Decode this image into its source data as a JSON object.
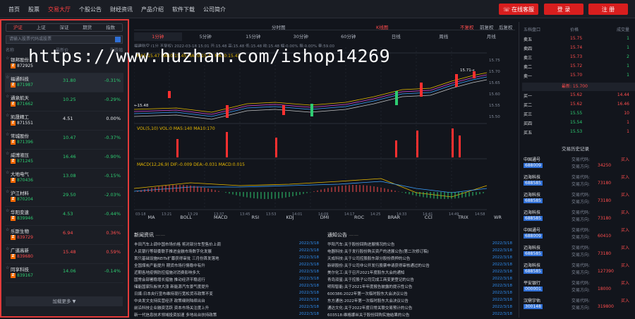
{
  "nav": {
    "items": [
      "首页",
      "股票",
      "交易大厅",
      "个股公告",
      "财经资讯",
      "产品介绍",
      "软件下载",
      "公司简介"
    ],
    "active_index": 2,
    "service_label": "在线客服",
    "login_label": "登 录",
    "register_label": "注 册"
  },
  "sidebar": {
    "tabs": [
      "沪证",
      "上证",
      "深证",
      "期货",
      "指数"
    ],
    "active_tab": 0,
    "search_placeholder": "请输入股票代码或股票",
    "headers": [
      "名称",
      "最新价",
      "涨跌幅"
    ],
    "load_more": "加载更多 ▼",
    "stocks": [
      {
        "name": "银邦股份",
        "code": "872925",
        "price": "",
        "change": "",
        "color": "wh"
      },
      {
        "name": "福通科技",
        "code": "871987",
        "price": "31.80",
        "change": "-0.31%",
        "color": "dn"
      },
      {
        "name": "通泉航天",
        "code": "871662",
        "price": "10.25",
        "change": "-0.29%",
        "color": "dn"
      },
      {
        "name": "凯晟精工",
        "code": "871551",
        "price": "4.51",
        "change": "0.00%",
        "color": "wh"
      },
      {
        "name": "常城股份",
        "code": "871396",
        "price": "10.47",
        "change": "-0.37%",
        "color": "dn"
      },
      {
        "name": "威博液压",
        "code": "871245",
        "price": "16.46",
        "change": "-0.90%",
        "color": "dn"
      },
      {
        "name": "大地电气",
        "code": "870436",
        "price": "13.08",
        "change": "-0.15%",
        "color": "dn"
      },
      {
        "name": "沪江材料",
        "code": "870204",
        "price": "29.50",
        "change": "-2.03%",
        "color": "dn"
      },
      {
        "name": "华阳变速",
        "code": "839946",
        "price": "4.53",
        "change": "-0.44%",
        "color": "dn"
      },
      {
        "name": "乐斯生物",
        "code": "839729",
        "price": "6.94",
        "change": "0.36%",
        "color": "up"
      },
      {
        "name": "广道高新",
        "code": "839680",
        "price": "15.48",
        "change": "0.59%",
        "color": "up"
      },
      {
        "name": "同享科技",
        "code": "839167",
        "price": "14.06",
        "change": "-0.14%",
        "color": "dn"
      }
    ]
  },
  "chart": {
    "period_tabs": [
      "分时图",
      "K线图",
      "不复权",
      "前复权",
      "后复权"
    ],
    "active_period": 1,
    "active_adjust": 2,
    "interval_tabs": [
      "1分钟",
      "5分钟",
      "15分钟",
      "30分钟",
      "60分钟",
      "日线",
      "周线",
      "月线"
    ],
    "active_interval": 0,
    "info_line": "福建航空 (1分 不复权) 2022-03-18 15:01 开:15.48 高:15.48 低:15.48 收:15.48 幅:0.00% 振:0.00% 量:59.00",
    "ma_line": "MA5:15.47  MA10:15.45  MA20:15.43  MA30:15.43",
    "vol_line": "VOL(5,10) VOL:0  MA5:140  MA10:170",
    "macd_line": "MACD(12,26,9) DIF:-0.009  DEA:-0.031  MACD:0.015",
    "price_high": "15.71",
    "price_low": "15.48",
    "y_ticks": [
      "15.75",
      "15.70",
      "15.65",
      "15.60",
      "15.55",
      "15.50"
    ],
    "x_ticks": [
      "03-18",
      "13:21",
      "13:29",
      "13:37",
      "13:45",
      "13:53",
      "14:01",
      "14:09",
      "14:17",
      "14:25",
      "14:33",
      "14:41",
      "14:49",
      "14:58"
    ],
    "indicators": [
      "MA",
      "BOLL",
      "MACD",
      "RSI",
      "KDJ",
      "DMI",
      "ROC",
      "BRAR",
      "CCI",
      "TRIX",
      "WR"
    ]
  },
  "news": {
    "title": "新闻资讯",
    "items": [
      {
        "t": "丰田汽车上调中国市场价格 将对部分车型售价上调",
        "d": "2022/3/18"
      },
      {
        "t": "人民银行等部委联手推进金融市场数字化发展",
        "d": "2022/3/18"
      },
      {
        "t": "首只基础设施REITs扩募获得审批 三月份首发落地",
        "d": "2022/3/18"
      },
      {
        "t": "全国煤炭产能提升 期货市场行情稳中有升",
        "d": "2022/3/18"
      },
      {
        "t": "近期各地疫情防控措施对消费影响多大",
        "d": "2022/3/18"
      },
      {
        "t": "国常会部署稳增长措施 推动经济平稳运行",
        "d": "2022/3/18"
      },
      {
        "t": "储能国家队板块大涨 新能源汽车景气度提升",
        "d": "2022/3/18"
      },
      {
        "t": "日媒:日本央行宣布维持现行宽松货币政策不变",
        "d": "2022/3/18"
      },
      {
        "t": "中央发文支持民营经济 政策细则陆续出台",
        "d": "2022/3/18"
      },
      {
        "t": "前沿科技企业融资活跃 资本市场关注度上升",
        "d": "2022/3/18"
      },
      {
        "t": "新一代信息技术领域投资加速 多地出台扶持政策",
        "d": "2022/3/18"
      }
    ]
  },
  "announce": {
    "title": "通知公告",
    "items": [
      {
        "t": "华阳汽车:关于股份回购进展情况的公告",
        "d": "2022/3/18"
      },
      {
        "t": "电器科技:关于发行股份购买资产的进展公告(第二次修订稿)",
        "d": "2022/3/18"
      },
      {
        "t": "天成科技:关于公司控股股东部分股份质押的公告",
        "d": "2022/3/18"
      },
      {
        "t": "新研股份:关于公司非公开发行股票申请获得审核通过的公告",
        "d": "2022/3/18"
      },
      {
        "t": "美尔化工:关于召开2021年度股东大会的通知",
        "d": "2022/3/18"
      },
      {
        "t": "青岛双星:关于控股子公司完成工商变更登记的公告",
        "d": "2022/3/18"
      },
      {
        "t": "明阳智能:关于2021年年度报告披露的提示性公告",
        "d": "2022/3/18"
      },
      {
        "t": "600386:2022年第一次临时股东大会决议公告",
        "d": "2022/3/18"
      },
      {
        "t": "东方通信:2022年第一次临时股东大会决议公告",
        "d": "2022/3/18"
      },
      {
        "t": "通达文化:关于2022年度日常关联交易预计的公告",
        "d": "2022/3/18"
      },
      {
        "t": "603518:维格娜丝关于股份回购实施结果的公告",
        "d": "2022/3/18"
      }
    ]
  },
  "orderbook": {
    "title_cols": [
      "五档盘口",
      "价格",
      "成交量"
    ],
    "sells": [
      {
        "l": "卖五",
        "p": "15.75",
        "v": "1"
      },
      {
        "l": "卖四",
        "p": "15.74",
        "v": "1"
      },
      {
        "l": "卖三",
        "p": "15.73",
        "v": "2"
      },
      {
        "l": "卖二",
        "p": "15.72",
        "v": "1"
      },
      {
        "l": "卖一",
        "p": "15.70",
        "v": "1"
      }
    ],
    "last": "最新: 15.700",
    "buys": [
      {
        "l": "买一",
        "p": "15.62",
        "v": "14.44"
      },
      {
        "l": "买二",
        "p": "15.62",
        "v": "16.46"
      },
      {
        "l": "买三",
        "p": "15.55",
        "v": "10"
      },
      {
        "l": "买四",
        "p": "15.54",
        "v": "1"
      },
      {
        "l": "买五",
        "p": "15.53",
        "v": "1"
      }
    ]
  },
  "history": {
    "title": "交易历史记录",
    "rows": [
      {
        "n": "中国通号",
        "c": "688009",
        "p": "34250",
        "s": "买入"
      },
      {
        "n": "迈海科技",
        "c": "688585",
        "p": "73180",
        "s": "买入"
      },
      {
        "n": "迈海科技",
        "c": "688585",
        "p": "73180",
        "s": "买入"
      },
      {
        "n": "迈海科技",
        "c": "688585",
        "p": "73180",
        "s": "买入"
      },
      {
        "n": "中国通号",
        "c": "688009",
        "p": "60410",
        "s": "买入"
      },
      {
        "n": "迈海科技",
        "c": "688585",
        "p": "73180",
        "s": "买入"
      },
      {
        "n": "迈海科技",
        "c": "688585",
        "p": "127390",
        "s": "买入"
      },
      {
        "n": "平安银行",
        "c": "000001",
        "p": "18000",
        "s": "买入"
      },
      {
        "n": "汉鼎宇佑",
        "c": "300148",
        "p": "319800",
        "s": "买入"
      }
    ],
    "label_code": "交易代码:",
    "label_side": "交易方向:"
  },
  "watermark": "https://www.huzhan.com/ishop14269",
  "colors": {
    "accent": "#d81e1e",
    "up": "#ff4d4d",
    "down": "#2ecc71",
    "code_tag": "#2f6fd6"
  }
}
